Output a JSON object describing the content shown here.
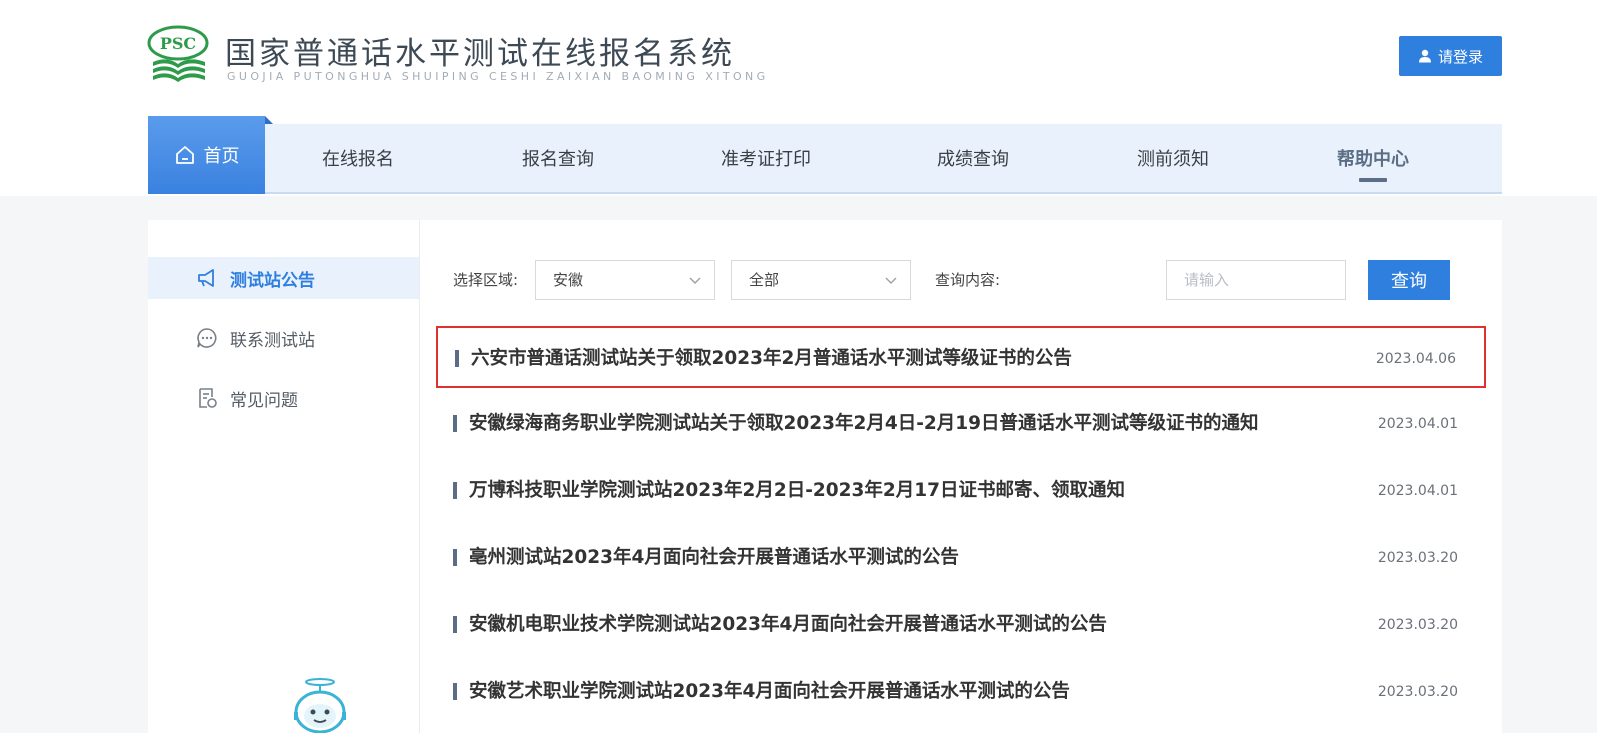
{
  "header": {
    "logo_mark_text": "PSC",
    "title": "国家普通话水平测试在线报名系统",
    "subtitle": "GUOJIA PUTONGHUA SHUIPING CESHI ZAIXIAN BAOMING XITONG",
    "login_label": "请登录"
  },
  "nav": {
    "home": "首页",
    "items": [
      "在线报名",
      "报名查询",
      "准考证打印",
      "成绩查询",
      "测前须知",
      "帮助中心"
    ],
    "active": "帮助中心"
  },
  "sidebar": {
    "items": [
      {
        "label": "测试站公告",
        "icon": "megaphone-icon",
        "active": true
      },
      {
        "label": "联系测试站",
        "icon": "chat-icon",
        "active": false
      },
      {
        "label": "常见问题",
        "icon": "document-icon",
        "active": false
      }
    ]
  },
  "filter": {
    "region_label": "选择区域:",
    "region_value": "安徽",
    "scope_value": "全部",
    "query_label": "查询内容:",
    "query_placeholder": "请输入",
    "query_value": "",
    "search_button": "查询"
  },
  "announcements": [
    {
      "title": "六安市普通话测试站关于领取2023年2月普通话水平测试等级证书的公告",
      "date": "2023.04.06"
    },
    {
      "title": "安徽绿海商务职业学院测试站关于领取2023年2月4日-2月19日普通话水平测试等级证书的通知",
      "date": "2023.04.01"
    },
    {
      "title": "万博科技职业学院测试站2023年2月2日-2023年2月17日证书邮寄、领取通知",
      "date": "2023.04.01"
    },
    {
      "title": "亳州测试站2023年4月面向社会开展普通话水平测试的公告",
      "date": "2023.03.20"
    },
    {
      "title": "安徽机电职业技术学院测试站2023年4月面向社会开展普通话水平测试的公告",
      "date": "2023.03.20"
    },
    {
      "title": "安徽艺术职业学院测试站2023年4月面向社会开展普通话水平测试的公告",
      "date": "2023.03.20"
    }
  ],
  "colors": {
    "accent": "#2f7fdf",
    "nav_bg": "#e9f2fc",
    "highlight_border": "#e0312f",
    "logo_green": "#2e9b4a"
  }
}
